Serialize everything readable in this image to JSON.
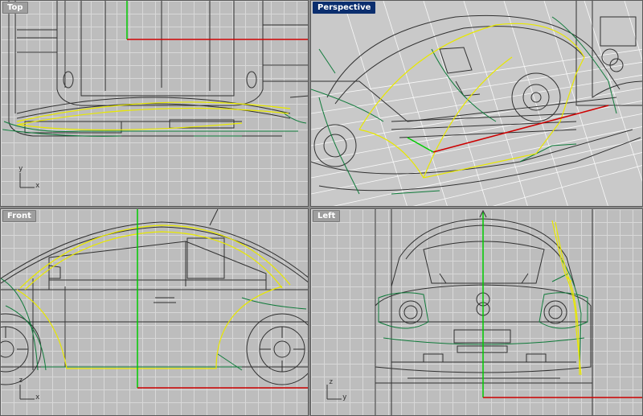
{
  "viewports": {
    "top": {
      "label": "Top",
      "axis_labels": {
        "h": "x",
        "v": "y"
      }
    },
    "perspective": {
      "label": "Perspective",
      "active": true
    },
    "front": {
      "label": "Front",
      "axis_labels": {
        "h": "x",
        "v": "z"
      }
    },
    "left": {
      "label": "Left",
      "axis_labels": {
        "h": "y",
        "v": "z"
      }
    }
  },
  "colors": {
    "viewport_bg": "#bdbdbd",
    "grid": "#d8d8d8",
    "active_label_bg": "#0b2e6e",
    "x_axis": "#cc0000",
    "y_axis": "#00cc00",
    "curve_selected": "#e8e800",
    "curve_green": "#0f7a3a",
    "wire": "#303030"
  }
}
